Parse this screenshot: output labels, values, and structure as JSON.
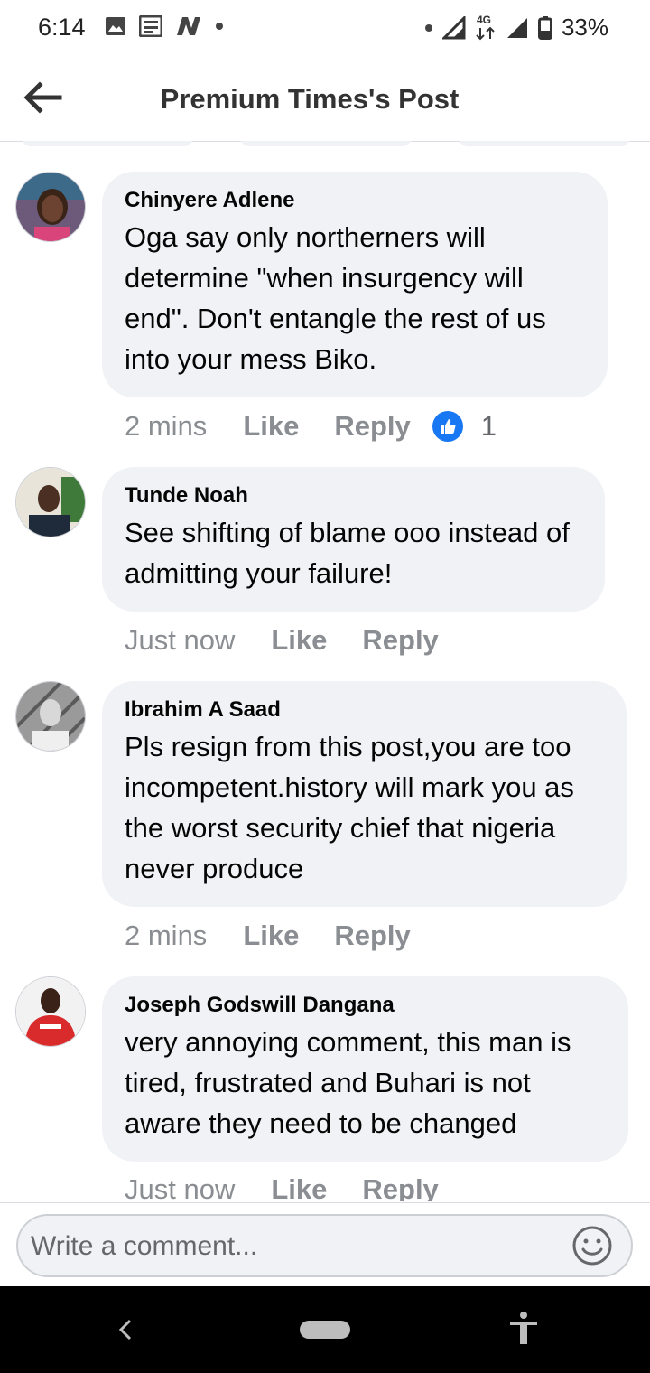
{
  "status_bar": {
    "time": "6:14",
    "battery": "33%",
    "network": "4G",
    "left_icons": [
      "image-icon",
      "news-icon",
      "n-app-icon",
      "dot-icon"
    ],
    "right_icons": [
      "dot-icon",
      "signal-icon",
      "data-arrows-icon",
      "signal-icon",
      "battery-icon"
    ]
  },
  "header": {
    "title": "Premium Times's Post",
    "back_icon": "arrow-left-icon"
  },
  "comments": [
    {
      "author": "Chinyere Adlene",
      "text": "Oga say only northerners will determine \"when insurgency will end\". Don't entangle the rest of us into your mess Biko.",
      "time": "2 mins",
      "like_label": "Like",
      "reply_label": "Reply",
      "reaction_count": "1"
    },
    {
      "author": "Tunde Noah",
      "text": "See shifting of blame ooo instead of admitting your failure!",
      "time": "Just now",
      "like_label": "Like",
      "reply_label": "Reply"
    },
    {
      "author": "Ibrahim A Saad",
      "text": "Pls resign from this post,you are too incompetent.history will mark you as the worst security chief that nigeria never produce",
      "time": "2 mins",
      "like_label": "Like",
      "reply_label": "Reply"
    },
    {
      "author": "Joseph Godswill Dangana",
      "text": "very annoying comment, this man is tired, frustrated and Buhari is not aware they need to be changed",
      "time": "Just now",
      "like_label": "Like",
      "reply_label": "Reply"
    }
  ],
  "composer": {
    "placeholder": "Write a comment...",
    "emoji_icon": "smiley-icon"
  },
  "colors": {
    "bubble": "#f0f2f5",
    "meta_text": "#8a8d91",
    "like_badge": "#1877f2",
    "nav_bar": "#000000"
  }
}
